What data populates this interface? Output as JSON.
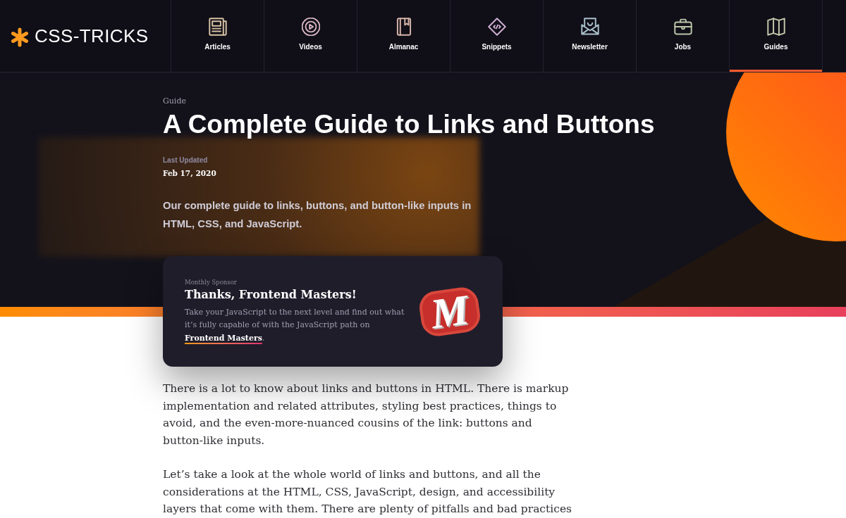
{
  "header": {
    "logo_text": "CSS-TRICKS",
    "nav": [
      {
        "label": "Articles",
        "selected": false
      },
      {
        "label": "Videos",
        "selected": false
      },
      {
        "label": "Almanac",
        "selected": false
      },
      {
        "label": "Snippets",
        "selected": false
      },
      {
        "label": "Newsletter",
        "selected": false
      },
      {
        "label": "Jobs",
        "selected": false
      },
      {
        "label": "Guides",
        "selected": true
      }
    ]
  },
  "hero": {
    "eyebrow": "Guide",
    "title": "A Complete Guide to Links and Buttons",
    "updated_label": "Last Updated",
    "updated_date": "Feb 17, 2020",
    "summary": "Our complete guide to links, buttons, and button-like inputs in HTML, CSS, and JavaScript."
  },
  "sponsor": {
    "label": "Monthly Sponsor",
    "title": "Thanks, Frontend Masters!",
    "text": "Take your JavaScript to the next level and find out what it’s fully capable of with the JavaScript path on",
    "link": "Frontend Masters",
    "text_end": ".",
    "logo_text": "M"
  },
  "article": {
    "paragraphs": [
      "There is a lot to know about links and buttons in HTML. There is markup implementation and related attributes, styling best practices, things to avoid, and the even-more-nuanced cousins of the link: buttons and button-like inputs.",
      "Let’s take a look at the whole world of links and buttons, and all the considerations at the HTML, CSS, JavaScript, design, and accessibility layers that come with them. There are plenty of pitfalls and bad practices"
    ]
  }
}
